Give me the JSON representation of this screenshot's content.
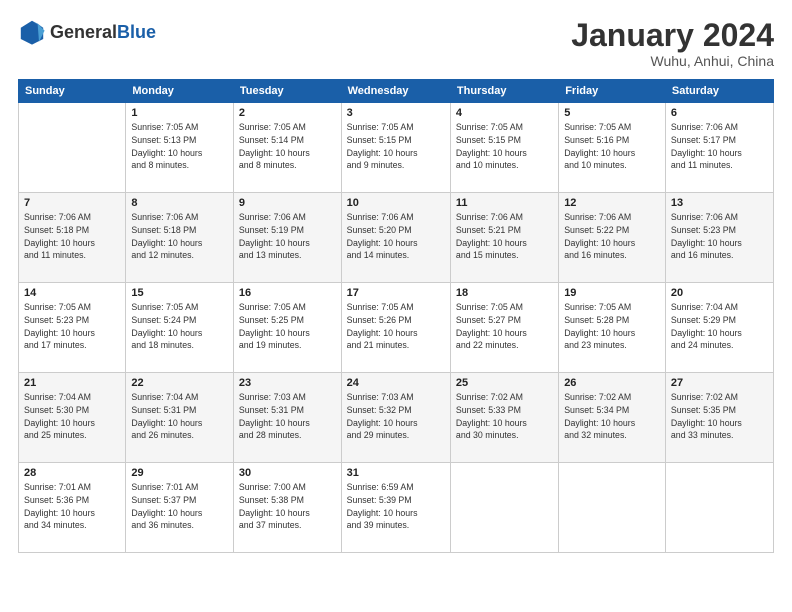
{
  "header": {
    "logo_general": "General",
    "logo_blue": "Blue",
    "month_title": "January 2024",
    "location": "Wuhu, Anhui, China"
  },
  "weekdays": [
    "Sunday",
    "Monday",
    "Tuesday",
    "Wednesday",
    "Thursday",
    "Friday",
    "Saturday"
  ],
  "weeks": [
    [
      {
        "day": "",
        "info": ""
      },
      {
        "day": "1",
        "info": "Sunrise: 7:05 AM\nSunset: 5:13 PM\nDaylight: 10 hours\nand 8 minutes."
      },
      {
        "day": "2",
        "info": "Sunrise: 7:05 AM\nSunset: 5:14 PM\nDaylight: 10 hours\nand 8 minutes."
      },
      {
        "day": "3",
        "info": "Sunrise: 7:05 AM\nSunset: 5:15 PM\nDaylight: 10 hours\nand 9 minutes."
      },
      {
        "day": "4",
        "info": "Sunrise: 7:05 AM\nSunset: 5:15 PM\nDaylight: 10 hours\nand 10 minutes."
      },
      {
        "day": "5",
        "info": "Sunrise: 7:05 AM\nSunset: 5:16 PM\nDaylight: 10 hours\nand 10 minutes."
      },
      {
        "day": "6",
        "info": "Sunrise: 7:06 AM\nSunset: 5:17 PM\nDaylight: 10 hours\nand 11 minutes."
      }
    ],
    [
      {
        "day": "7",
        "info": "Sunrise: 7:06 AM\nSunset: 5:18 PM\nDaylight: 10 hours\nand 11 minutes."
      },
      {
        "day": "8",
        "info": "Sunrise: 7:06 AM\nSunset: 5:18 PM\nDaylight: 10 hours\nand 12 minutes."
      },
      {
        "day": "9",
        "info": "Sunrise: 7:06 AM\nSunset: 5:19 PM\nDaylight: 10 hours\nand 13 minutes."
      },
      {
        "day": "10",
        "info": "Sunrise: 7:06 AM\nSunset: 5:20 PM\nDaylight: 10 hours\nand 14 minutes."
      },
      {
        "day": "11",
        "info": "Sunrise: 7:06 AM\nSunset: 5:21 PM\nDaylight: 10 hours\nand 15 minutes."
      },
      {
        "day": "12",
        "info": "Sunrise: 7:06 AM\nSunset: 5:22 PM\nDaylight: 10 hours\nand 16 minutes."
      },
      {
        "day": "13",
        "info": "Sunrise: 7:06 AM\nSunset: 5:23 PM\nDaylight: 10 hours\nand 16 minutes."
      }
    ],
    [
      {
        "day": "14",
        "info": "Sunrise: 7:05 AM\nSunset: 5:23 PM\nDaylight: 10 hours\nand 17 minutes."
      },
      {
        "day": "15",
        "info": "Sunrise: 7:05 AM\nSunset: 5:24 PM\nDaylight: 10 hours\nand 18 minutes."
      },
      {
        "day": "16",
        "info": "Sunrise: 7:05 AM\nSunset: 5:25 PM\nDaylight: 10 hours\nand 19 minutes."
      },
      {
        "day": "17",
        "info": "Sunrise: 7:05 AM\nSunset: 5:26 PM\nDaylight: 10 hours\nand 21 minutes."
      },
      {
        "day": "18",
        "info": "Sunrise: 7:05 AM\nSunset: 5:27 PM\nDaylight: 10 hours\nand 22 minutes."
      },
      {
        "day": "19",
        "info": "Sunrise: 7:05 AM\nSunset: 5:28 PM\nDaylight: 10 hours\nand 23 minutes."
      },
      {
        "day": "20",
        "info": "Sunrise: 7:04 AM\nSunset: 5:29 PM\nDaylight: 10 hours\nand 24 minutes."
      }
    ],
    [
      {
        "day": "21",
        "info": "Sunrise: 7:04 AM\nSunset: 5:30 PM\nDaylight: 10 hours\nand 25 minutes."
      },
      {
        "day": "22",
        "info": "Sunrise: 7:04 AM\nSunset: 5:31 PM\nDaylight: 10 hours\nand 26 minutes."
      },
      {
        "day": "23",
        "info": "Sunrise: 7:03 AM\nSunset: 5:31 PM\nDaylight: 10 hours\nand 28 minutes."
      },
      {
        "day": "24",
        "info": "Sunrise: 7:03 AM\nSunset: 5:32 PM\nDaylight: 10 hours\nand 29 minutes."
      },
      {
        "day": "25",
        "info": "Sunrise: 7:02 AM\nSunset: 5:33 PM\nDaylight: 10 hours\nand 30 minutes."
      },
      {
        "day": "26",
        "info": "Sunrise: 7:02 AM\nSunset: 5:34 PM\nDaylight: 10 hours\nand 32 minutes."
      },
      {
        "day": "27",
        "info": "Sunrise: 7:02 AM\nSunset: 5:35 PM\nDaylight: 10 hours\nand 33 minutes."
      }
    ],
    [
      {
        "day": "28",
        "info": "Sunrise: 7:01 AM\nSunset: 5:36 PM\nDaylight: 10 hours\nand 34 minutes."
      },
      {
        "day": "29",
        "info": "Sunrise: 7:01 AM\nSunset: 5:37 PM\nDaylight: 10 hours\nand 36 minutes."
      },
      {
        "day": "30",
        "info": "Sunrise: 7:00 AM\nSunset: 5:38 PM\nDaylight: 10 hours\nand 37 minutes."
      },
      {
        "day": "31",
        "info": "Sunrise: 6:59 AM\nSunset: 5:39 PM\nDaylight: 10 hours\nand 39 minutes."
      },
      {
        "day": "",
        "info": ""
      },
      {
        "day": "",
        "info": ""
      },
      {
        "day": "",
        "info": ""
      }
    ]
  ]
}
